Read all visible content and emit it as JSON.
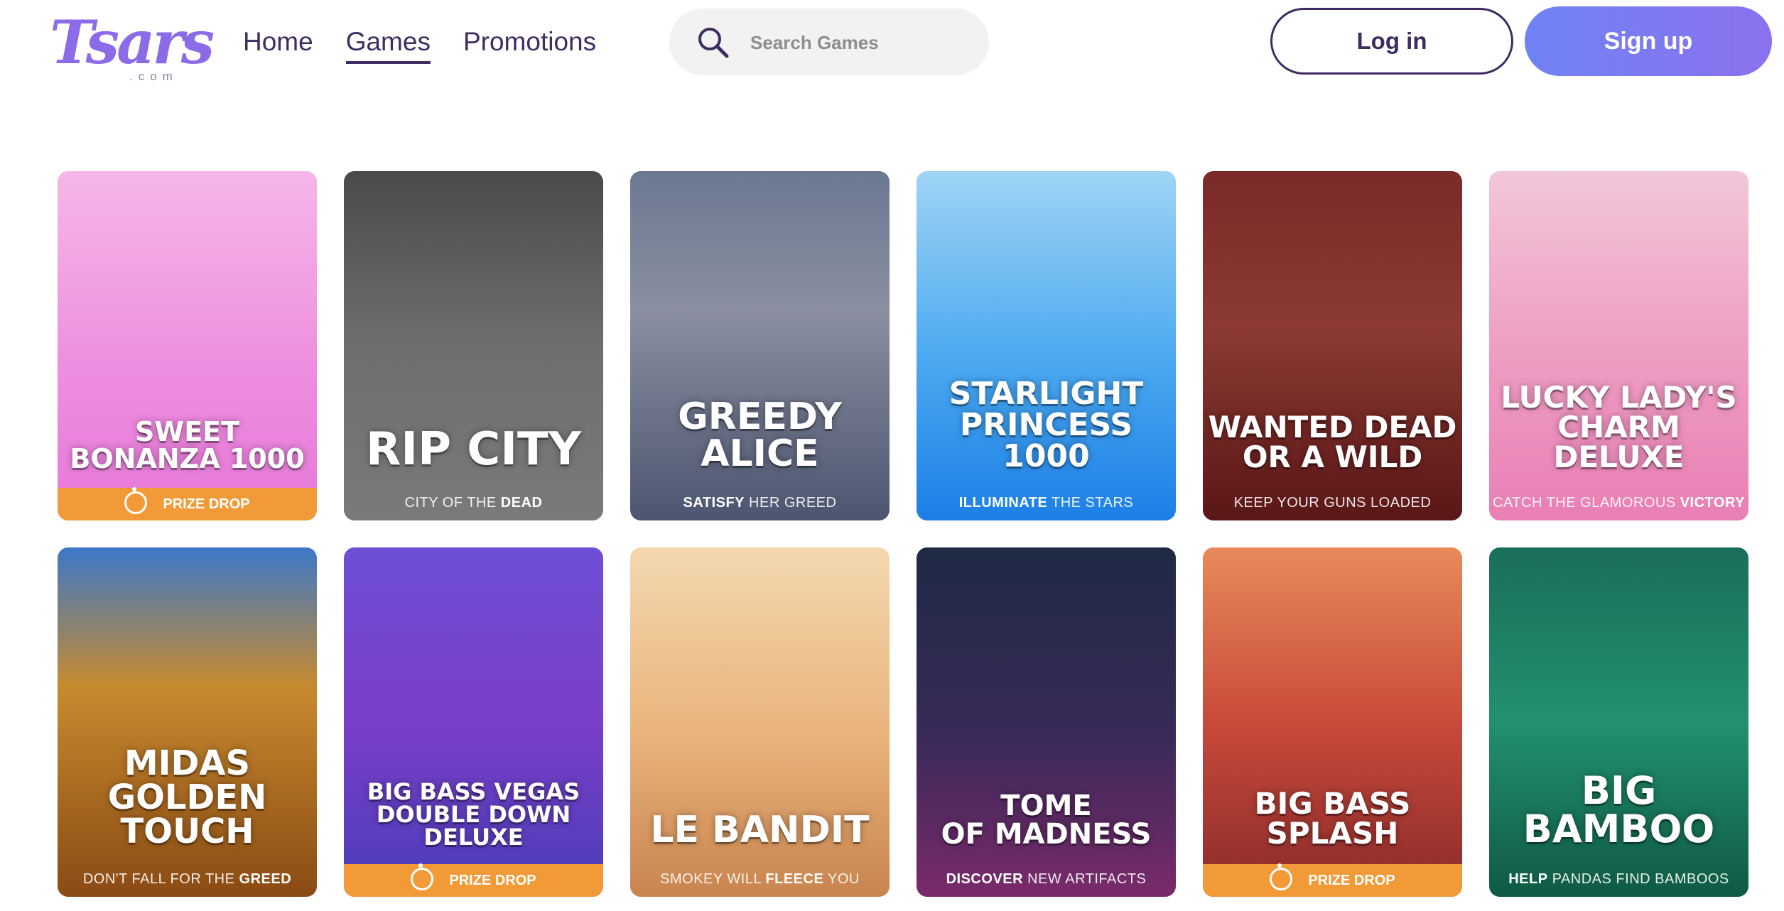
{
  "header": {
    "logo": {
      "text": "Tsars",
      "suffix": ".com"
    },
    "nav": [
      {
        "label": "Home",
        "active": false
      },
      {
        "label": "Games",
        "active": true
      },
      {
        "label": "Promotions",
        "active": false
      }
    ],
    "search": {
      "placeholder": "Search Games",
      "value": ""
    },
    "login_label": "Log in",
    "signup_label": "Sign up"
  },
  "colors": {
    "accent": "#7b7ff0",
    "prize_drop": "#f29a37",
    "text_dark": "#3e2c63"
  },
  "games": [
    {
      "title": "SWEET\nBONANZA 1000",
      "tagline_pre": "",
      "tagline_bold": "",
      "tagline_post": "",
      "prize_drop": "PRIZE DROP",
      "bg": "linear-gradient(180deg,#f5b7e7 0%,#ee8fe0 55%,#e678d8 100%)",
      "title_size": 38
    },
    {
      "title": "RIP CITY",
      "tagline_pre": "CITY OF THE ",
      "tagline_bold": "DEAD",
      "tagline_post": "",
      "prize_drop": "",
      "bg": "linear-gradient(180deg,#4a4a4a 0%,#6e6e6e 50%,#7a7a7a 100%)",
      "title_size": 64
    },
    {
      "title": "GREEDY ALICE",
      "tagline_pre": "",
      "tagline_bold": "SATISFY",
      "tagline_post": " HER GREED",
      "prize_drop": "",
      "bg": "linear-gradient(180deg,#6b7892 0%,#8a8fa0 40%,#4c5570 100%)",
      "title_size": 52
    },
    {
      "title": "STARLIGHT\nPRINCESS 1000",
      "tagline_pre": "",
      "tagline_bold": "ILLUMINATE",
      "tagline_post": " THE STARS",
      "prize_drop": "",
      "bg": "linear-gradient(180deg,#9fd4f4 0%,#4aa8f0 55%,#1c7fe6 100%)",
      "title_size": 44
    },
    {
      "title": "WANTED DEAD\nOR A WILD",
      "tagline_pre": "KEEP YOUR GUNS LOADED",
      "tagline_bold": "",
      "tagline_post": "",
      "prize_drop": "",
      "bg": "linear-gradient(180deg,#7a2a28 0%,#8c3a33 45%,#5a1616 100%)",
      "title_size": 42
    },
    {
      "title": "LUCKY LADY'S\nCHARM DELUXE",
      "tagline_pre": "CATCH THE GLAMOROUS ",
      "tagline_bold": "VICTORY",
      "tagline_post": "",
      "prize_drop": "",
      "bg": "linear-gradient(180deg,#f2c7d9 0%,#ee9fc4 50%,#e97fb5 100%)",
      "title_size": 42
    },
    {
      "title": "MIDAS\nGOLDEN TOUCH",
      "tagline_pre": "DON'T FALL FOR THE ",
      "tagline_bold": "GREED",
      "tagline_post": "",
      "prize_drop": "",
      "bg": "linear-gradient(180deg,#3c78c8 0%,#c88a2e 40%,#8a4a14 100%)",
      "title_size": 48
    },
    {
      "title": "BIG BASS VEGAS\nDOUBLE DOWN DELUXE",
      "tagline_pre": "",
      "tagline_bold": "",
      "tagline_post": "",
      "prize_drop": "PRIZE DROP",
      "bg": "linear-gradient(180deg,#6e4fd6 0%,#7a3ec8 50%,#4a3db8 100%)",
      "title_size": 32
    },
    {
      "title": "LE BANDIT",
      "tagline_pre": "SMOKEY WILL ",
      "tagline_bold": "FLEECE",
      "tagline_post": " YOU",
      "prize_drop": "",
      "bg": "linear-gradient(180deg,#f4d8b0 0%,#e8b27a 55%,#c9844e 100%)",
      "title_size": 52
    },
    {
      "title": "TOME\nOF MADNESS",
      "tagline_pre": "",
      "tagline_bold": "DISCOVER",
      "tagline_post": " NEW ARTIFACTS",
      "prize_drop": "",
      "bg": "linear-gradient(180deg,#1e2a44 0%,#3a2a5a 55%,#7a2a6a 100%)",
      "title_size": 40
    },
    {
      "title": "BIG BASS SPLASH",
      "tagline_pre": "",
      "tagline_bold": "",
      "tagline_post": "",
      "prize_drop": "PRIZE DROP",
      "bg": "linear-gradient(180deg,#e88a5a 0%,#c84a3a 50%,#8a2a2a 100%)",
      "title_size": 42
    },
    {
      "title": "BIG BAMBOO",
      "tagline_pre": "",
      "tagline_bold": "HELP",
      "tagline_post": " PANDAS FIND BAMBOOS",
      "prize_drop": "",
      "bg": "linear-gradient(180deg,#1a6e5a 0%,#22906e 50%,#0f5a44 100%)",
      "title_size": 54
    }
  ]
}
